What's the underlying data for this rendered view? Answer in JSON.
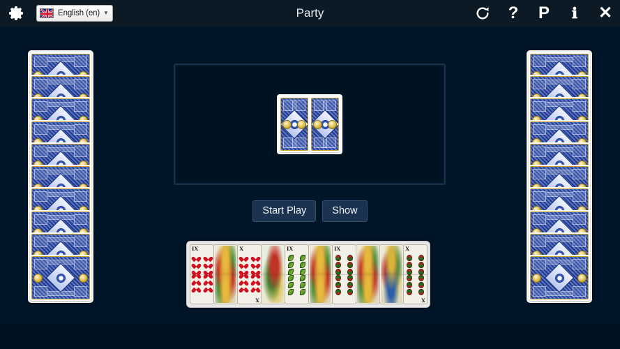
{
  "app": {
    "title": "Party",
    "background_color": "#001527",
    "header_color": "#0b1a24"
  },
  "header": {
    "settings_icon": "gear-icon",
    "language": {
      "label": "English (en)",
      "flag": "uk-flag",
      "caret": "▼"
    },
    "title": "Party",
    "icons": [
      {
        "name": "refresh-icon",
        "glyph": "↻",
        "label": "Refresh"
      },
      {
        "name": "help-icon",
        "glyph": "?",
        "label": "Help"
      },
      {
        "name": "parties-icon",
        "glyph": "P",
        "label": "Parties"
      },
      {
        "name": "info-icon",
        "glyph": "ℹ",
        "label": "Info"
      },
      {
        "name": "close-icon",
        "glyph": "✕",
        "label": "Close"
      }
    ]
  },
  "table": {
    "trick_cards": [
      {
        "name": "trick-card-1",
        "face": "back"
      },
      {
        "name": "trick-card-2",
        "face": "back"
      }
    ]
  },
  "buttons": [
    {
      "name": "start-play-button",
      "label": "Start Play"
    },
    {
      "name": "show-button",
      "label": "Show"
    }
  ],
  "opponents": {
    "left": {
      "name": "left-opponent-hand",
      "card_count": 10,
      "face": "back"
    },
    "right": {
      "name": "right-opponent-hand",
      "card_count": 10,
      "face": "back"
    }
  },
  "hand": {
    "cards": [
      {
        "rank": "IX",
        "suit": "hearts",
        "kind": "pip",
        "rank_bottom": ""
      },
      {
        "rank": "",
        "suit": "hearts",
        "kind": "court",
        "rank_bottom": ""
      },
      {
        "rank": "X",
        "suit": "hearts",
        "kind": "pip",
        "rank_bottom": "X"
      },
      {
        "rank": "",
        "suit": "hearts",
        "kind": "scene",
        "rank_bottom": ""
      },
      {
        "rank": "IX",
        "suit": "leaves",
        "kind": "pip",
        "rank_bottom": ""
      },
      {
        "rank": "",
        "suit": "leaves",
        "kind": "court",
        "rank_bottom": ""
      },
      {
        "rank": "IX",
        "suit": "acorns",
        "kind": "pip",
        "rank_bottom": ""
      },
      {
        "rank": "",
        "suit": "acorns",
        "kind": "court",
        "rank_bottom": ""
      },
      {
        "rank": "",
        "suit": "acorns",
        "kind": "blue",
        "rank_bottom": ""
      },
      {
        "rank": "X",
        "suit": "acorns",
        "kind": "pip",
        "rank_bottom": "X"
      }
    ]
  }
}
